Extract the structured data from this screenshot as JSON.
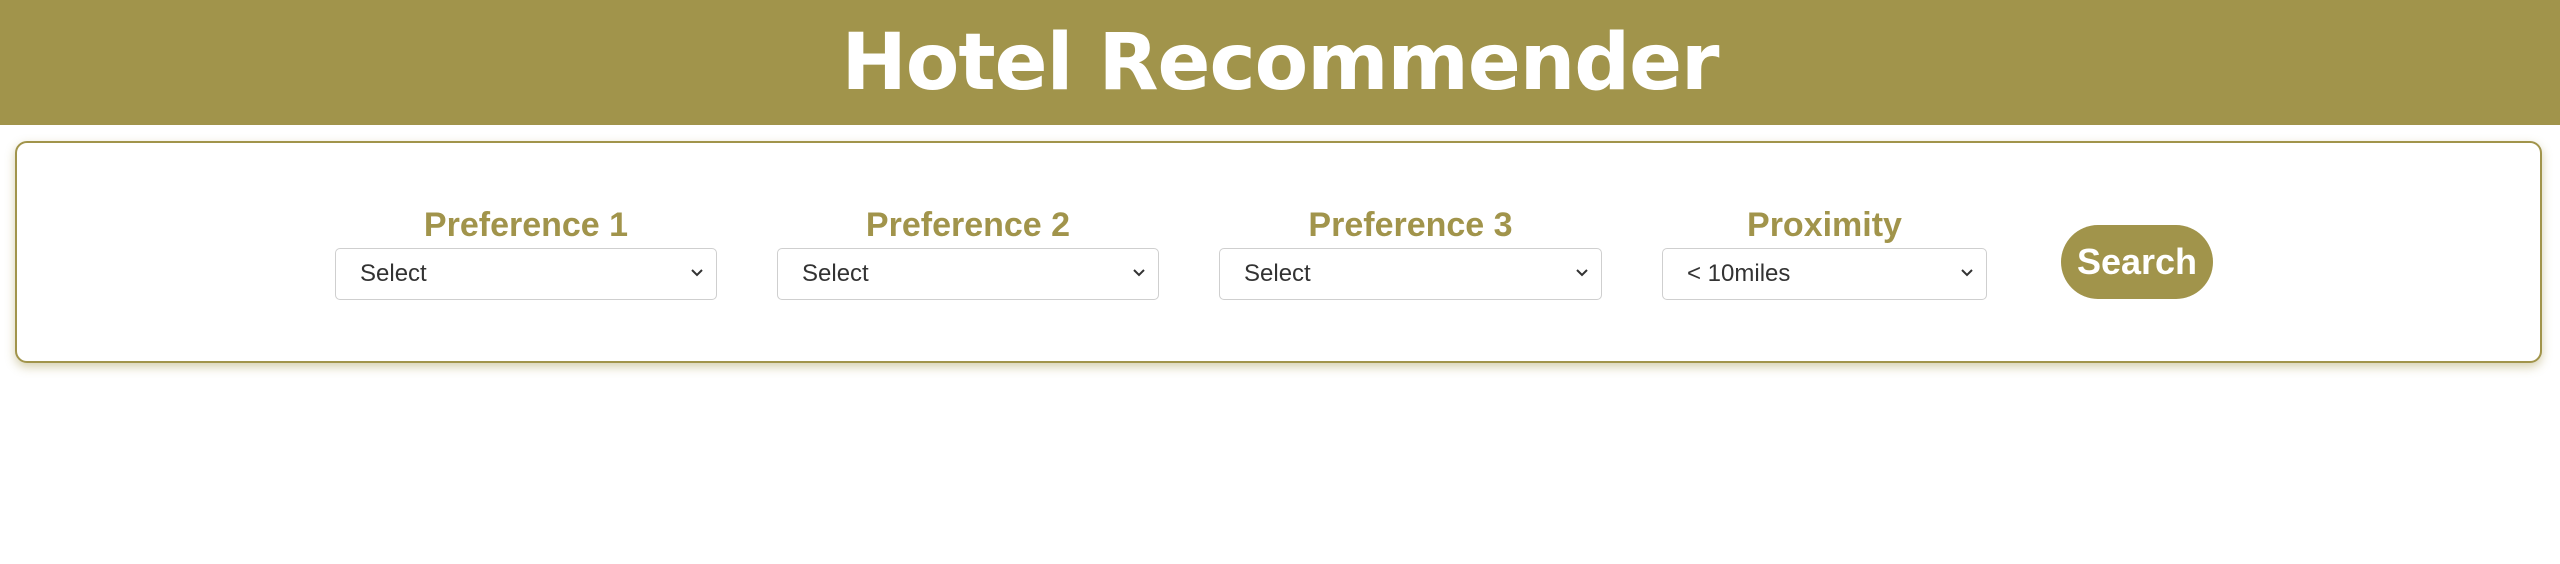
{
  "header": {
    "title": "Hotel Recommender"
  },
  "form": {
    "fields": [
      {
        "label": "Preference 1",
        "value": "Select"
      },
      {
        "label": "Preference 2",
        "value": "Select"
      },
      {
        "label": "Preference 3",
        "value": "Select"
      },
      {
        "label": "Proximity",
        "value": "< 10miles"
      }
    ],
    "search_label": "Search"
  },
  "colors": {
    "brand": "#a1944b",
    "background": "#ffffff"
  },
  "icons": {
    "dropdown": "chevron-down-icon"
  }
}
